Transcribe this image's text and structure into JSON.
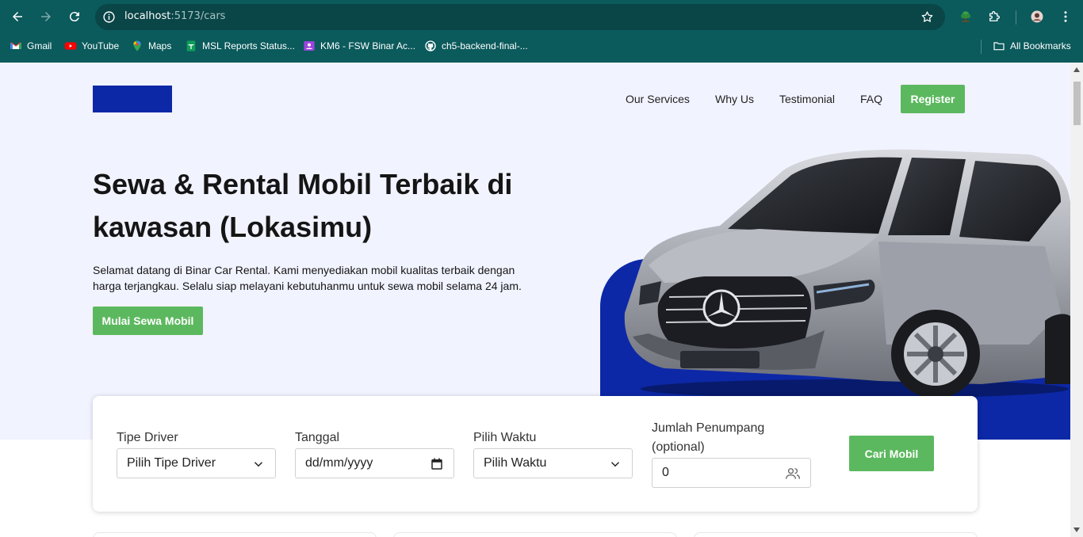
{
  "browser": {
    "url_host": "localhost",
    "url_path": ":5173/cars",
    "bookmarks": [
      {
        "label": "Gmail",
        "icon": "gmail-icon"
      },
      {
        "label": "YouTube",
        "icon": "youtube-icon"
      },
      {
        "label": "Maps",
        "icon": "maps-icon"
      },
      {
        "label": "MSL Reports Status...",
        "icon": "sheets-icon"
      },
      {
        "label": "KM6 - FSW Binar Ac...",
        "icon": "classroom-icon"
      },
      {
        "label": "ch5-backend-final-...",
        "icon": "github-icon"
      }
    ],
    "all_bookmarks": "All Bookmarks"
  },
  "nav": {
    "links": [
      "Our Services",
      "Why Us",
      "Testimonial",
      "FAQ"
    ],
    "register": "Register"
  },
  "hero": {
    "title": "Sewa & Rental Mobil Terbaik di kawasan (Lokasimu)",
    "description": "Selamat datang di Binar Car Rental. Kami menyediakan mobil kualitas terbaik dengan harga terjangkau. Selalu siap melayani kebutuhanmu untuk sewa mobil selama 24 jam.",
    "cta": "Mulai Sewa Mobil"
  },
  "search": {
    "driver_label": "Tipe Driver",
    "driver_value": "Pilih Tipe Driver",
    "date_label": "Tanggal",
    "date_value": "dd/mm/yyyy",
    "time_label": "Pilih Waktu",
    "time_value": "Pilih Waktu",
    "passenger_label": "Jumlah Penumpang (optional)",
    "passenger_value": "0",
    "submit": "Cari Mobil"
  },
  "colors": {
    "chrome": "#0b5a5c",
    "brand_blue": "#0d28a6",
    "green": "#5cb85f",
    "hero_bg": "#f1f3ff"
  }
}
